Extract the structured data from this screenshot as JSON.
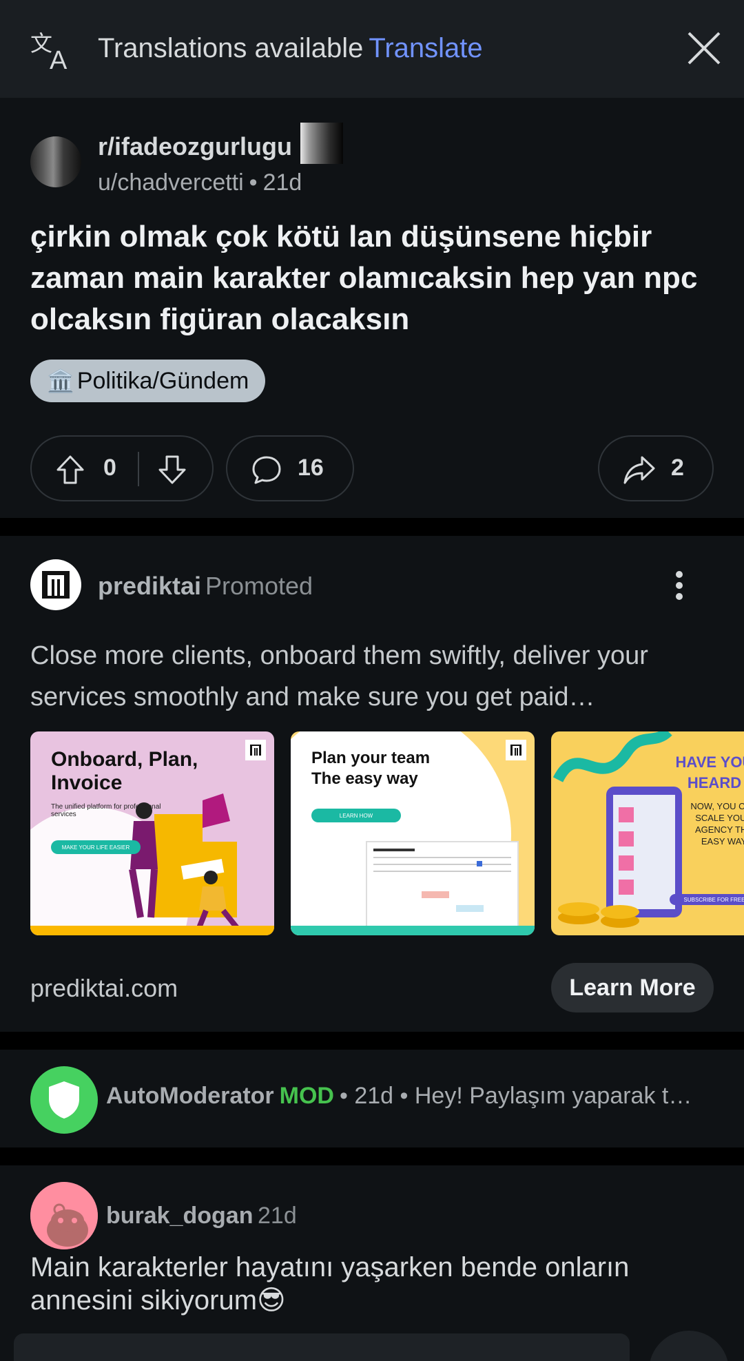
{
  "banner": {
    "text": "Translations available",
    "link": "Translate"
  },
  "post": {
    "subreddit": "r/ifadeozgurlugu",
    "author": "u/chadvercetti",
    "age": "21d",
    "title": "çirkin olmak çok kötü lan düşünsene hiçbir zaman main karakter olamıcaksin hep yan npc olcaksın figüran olacaksın",
    "flair_icon": "🏛️",
    "flair_text": "Politika/Gündem",
    "votes": "0",
    "comments": "16",
    "shares": "2"
  },
  "ad": {
    "advertiser": "prediktai",
    "promoted": "Promoted",
    "body": "Close more clients, onboard them swiftly, deliver your services smoothly and make sure you get paid…",
    "cards": [
      {
        "title": "Onboard, Plan, Invoice",
        "subtitle": "The unified platform for professional services",
        "button": "MAKE YOUR LIFE EASIER"
      },
      {
        "title": "Plan your team The easy way",
        "subtitle": "",
        "button": "LEARN HOW"
      },
      {
        "title": "HAVE YOU HEARD",
        "subtitle": "NOW, YOU CAN SCALE YOUR AGENCY THE EASY WAY",
        "button": "SUBSCRIBE FOR FREE"
      }
    ],
    "domain": "prediktai.com",
    "cta": "Learn More"
  },
  "automod": {
    "name": "AutoModerator",
    "badge": "MOD",
    "age": "21d",
    "snippet": "Hey! Paylaşım yaparak t…"
  },
  "comment": {
    "username": "burak_dogan",
    "age": "21d",
    "body": "Main karakterler hayatını yaşarken bende onların annesini sikiyorum😎"
  },
  "colors": {
    "accent_link": "#7193ff",
    "mod_green": "#46c24e",
    "automod_avatar": "#46d160",
    "flair_bg": "#b9c3cb"
  }
}
